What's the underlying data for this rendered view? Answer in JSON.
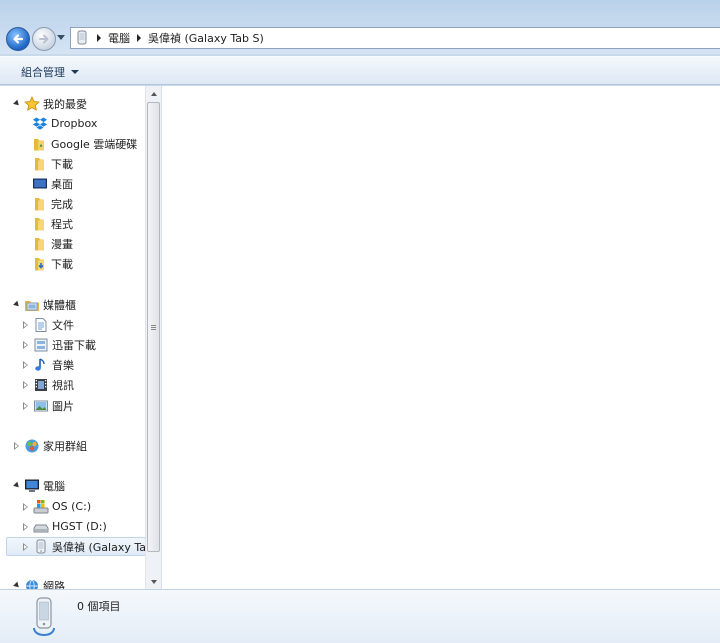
{
  "address": {
    "crumbs": [
      "電腦",
      "吳偉禎 (Galaxy Tab S)"
    ]
  },
  "toolbar": {
    "organize_label": "組合管理"
  },
  "nav": {
    "favorites": {
      "label": "我的最愛",
      "items": [
        "Dropbox",
        "Google 雲端硬碟",
        "下載",
        "桌面",
        "完成",
        "程式",
        "漫畫",
        "下載"
      ]
    },
    "libraries": {
      "label": "媒體櫃",
      "items": [
        "文件",
        "迅雷下載",
        "音樂",
        "視訊",
        "圖片"
      ]
    },
    "homegroup": {
      "label": "家用群組"
    },
    "computer": {
      "label": "電腦",
      "items": [
        "OS (C:)",
        "HGST (D:)",
        "吳偉禎 (Galaxy Tab S)"
      ]
    },
    "network": {
      "label": "網路"
    }
  },
  "details": {
    "item_count": "0 個項目"
  },
  "colors": {
    "accent": "#1b64c6",
    "folder": "#e8b83c",
    "selection": "#e1ebf6"
  }
}
